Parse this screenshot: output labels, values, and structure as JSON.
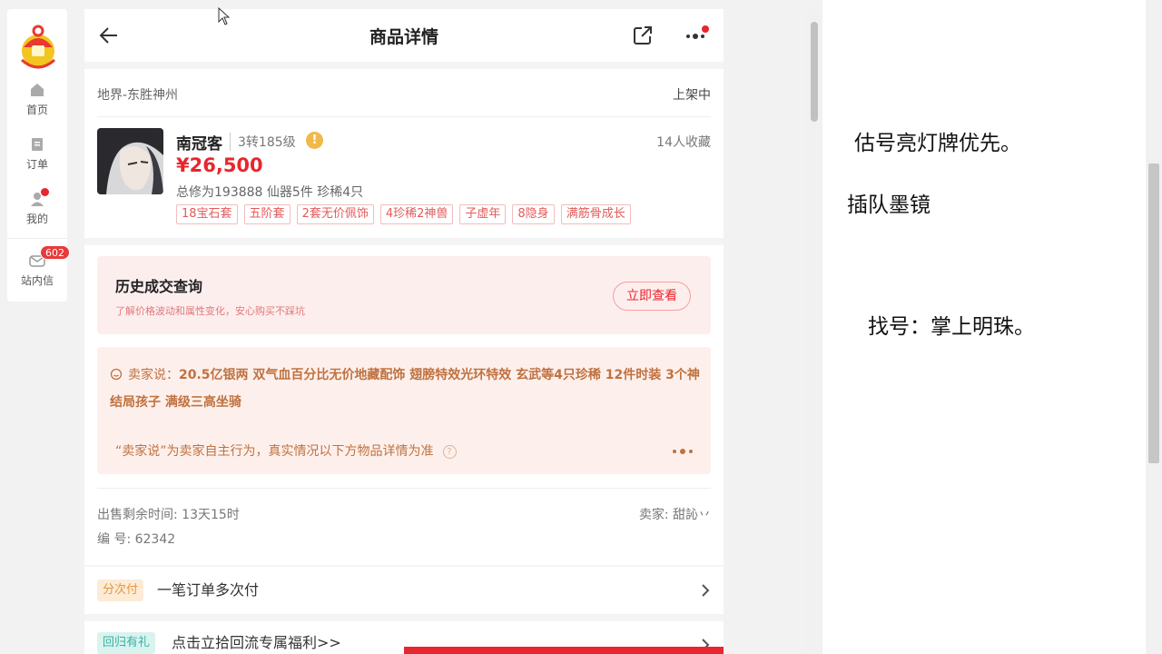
{
  "nav": {
    "items": [
      {
        "label": "首页",
        "icon": "home-icon"
      },
      {
        "label": "订单",
        "icon": "order-icon"
      },
      {
        "label": "我的",
        "icon": "user-icon"
      }
    ],
    "messages": {
      "label": "站内信",
      "badge": "602",
      "icon": "mail-icon"
    }
  },
  "header": {
    "title": "商品详情"
  },
  "product": {
    "server": "地界-东胜神州",
    "status": "上架中",
    "name": "南冠客",
    "level": "3转185级",
    "favorites": "14人收藏",
    "price": "¥26,500",
    "stats": "总修为193888  仙器5件  珍稀4只",
    "tags": [
      "18宝石套",
      "五阶套",
      "2套无价佩饰",
      "4珍稀2神兽",
      "子虚年",
      "8隐身",
      "满筋骨成长"
    ]
  },
  "history": {
    "title": "历史成交查询",
    "subtitle": "了解价格波动和属性变化，安心购买不踩坑",
    "button": "立即查看"
  },
  "seller_says": {
    "label": "卖家说：",
    "text": "20.5亿银两 双气血百分比无价地藏配饰 翅膀特效光环特效 玄武等4只珍稀 12件时装 3个神结局孩子 满级三高坐骑",
    "disclaimer": "“卖家说”为卖家自主行为，真实情况以下方物品详情为准"
  },
  "meta": {
    "remaining": "出售剩余时间: 13天15时",
    "seller": "卖家: 甜訫丷",
    "serial": "编 号: 62342"
  },
  "rows": [
    {
      "badge": "分次付",
      "text": "一笔订单多次付"
    },
    {
      "badge": "回归有礼",
      "text": "点击立拾回流专属福利>>"
    }
  ],
  "notes": [
    "估号亮灯牌优先。",
    "插队墨镜",
    "找号：掌上明珠。"
  ],
  "colors": {
    "accent": "#e8262d",
    "seller_text": "#c0713f"
  }
}
